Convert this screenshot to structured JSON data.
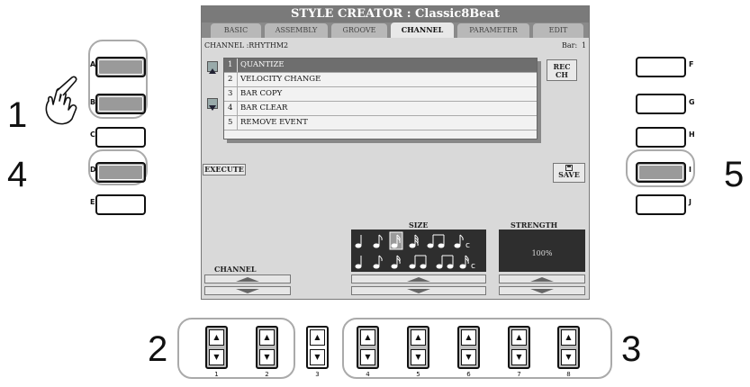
{
  "screen": {
    "title": "STYLE CREATOR : Classic8Beat",
    "tabs": [
      "BASIC",
      "ASSEMBLY",
      "GROOVE",
      "CHANNEL",
      "PARAMETER",
      "EDIT"
    ],
    "active_tab": "CHANNEL",
    "channel_label": "CHANNEL :RHYTHM2",
    "bar_label": "Bar:",
    "bar_value": "1",
    "menu_items": [
      {
        "num": "1",
        "label": "QUANTIZE"
      },
      {
        "num": "2",
        "label": "VELOCITY CHANGE"
      },
      {
        "num": "3",
        "label": "BAR COPY"
      },
      {
        "num": "4",
        "label": "BAR CLEAR"
      },
      {
        "num": "5",
        "label": "REMOVE EVENT"
      }
    ],
    "selected_item": "QUANTIZE",
    "rec_ch_line1": "REC",
    "rec_ch_line2": "CH",
    "execute_label": "EXECUTE",
    "save_label": "SAVE",
    "channel_panel_label": "CHANNEL",
    "size_label": "SIZE",
    "strength_label": "STRENGTH",
    "strength_value": "100%"
  },
  "left_buttons": [
    "A",
    "B",
    "C",
    "D",
    "E"
  ],
  "right_buttons": [
    "F",
    "G",
    "H",
    "I",
    "J"
  ],
  "bottom_buttons": [
    "1",
    "2",
    "3",
    "4",
    "5",
    "6",
    "7",
    "8"
  ],
  "step_numbers": [
    "1",
    "2",
    "3",
    "4",
    "5"
  ]
}
